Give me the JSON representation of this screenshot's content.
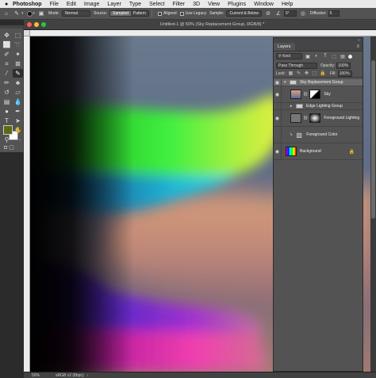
{
  "menubar": {
    "app": "Photoshop",
    "items": [
      "File",
      "Edit",
      "Image",
      "Layer",
      "Type",
      "Select",
      "Filter",
      "3D",
      "View",
      "Plugins",
      "Window",
      "Help"
    ]
  },
  "options": {
    "mode_label": "Mode:",
    "mode_value": "Normal",
    "source_label": "Source:",
    "source_sampled": "Sampled",
    "source_pattern": "Pattern",
    "aligned_label": "Aligned",
    "legacy_label": "Use Legacy",
    "sample_label": "Sample:",
    "sample_value": "Current & Below",
    "angle_value": "0°",
    "diffusion_label": "Diffusion:",
    "diffusion_value": "5"
  },
  "document": {
    "title": "Untitled-1 @ 50% (Sky Replacement Group, RGB/8) *",
    "zoom": "50%",
    "profile": "sRGB v2 (8bpc)"
  },
  "colors": {
    "foreground": "#5b6b14",
    "background": "#ffffff"
  },
  "layers_panel": {
    "tab": "Layers",
    "filter_kind": "Kind",
    "blend_mode": "Pass Through",
    "opacity_label": "Opacity:",
    "opacity_value": "100%",
    "lock_label": "Lock:",
    "fill_label": "Fill:",
    "fill_value": "100%",
    "layers": [
      {
        "name": "Sky Replacement Group"
      },
      {
        "name": "Sky"
      },
      {
        "name": "Edge Lighting Group"
      },
      {
        "name": "Foreground Lighting"
      },
      {
        "name": "Foreground Color"
      },
      {
        "name": "Background"
      }
    ]
  }
}
